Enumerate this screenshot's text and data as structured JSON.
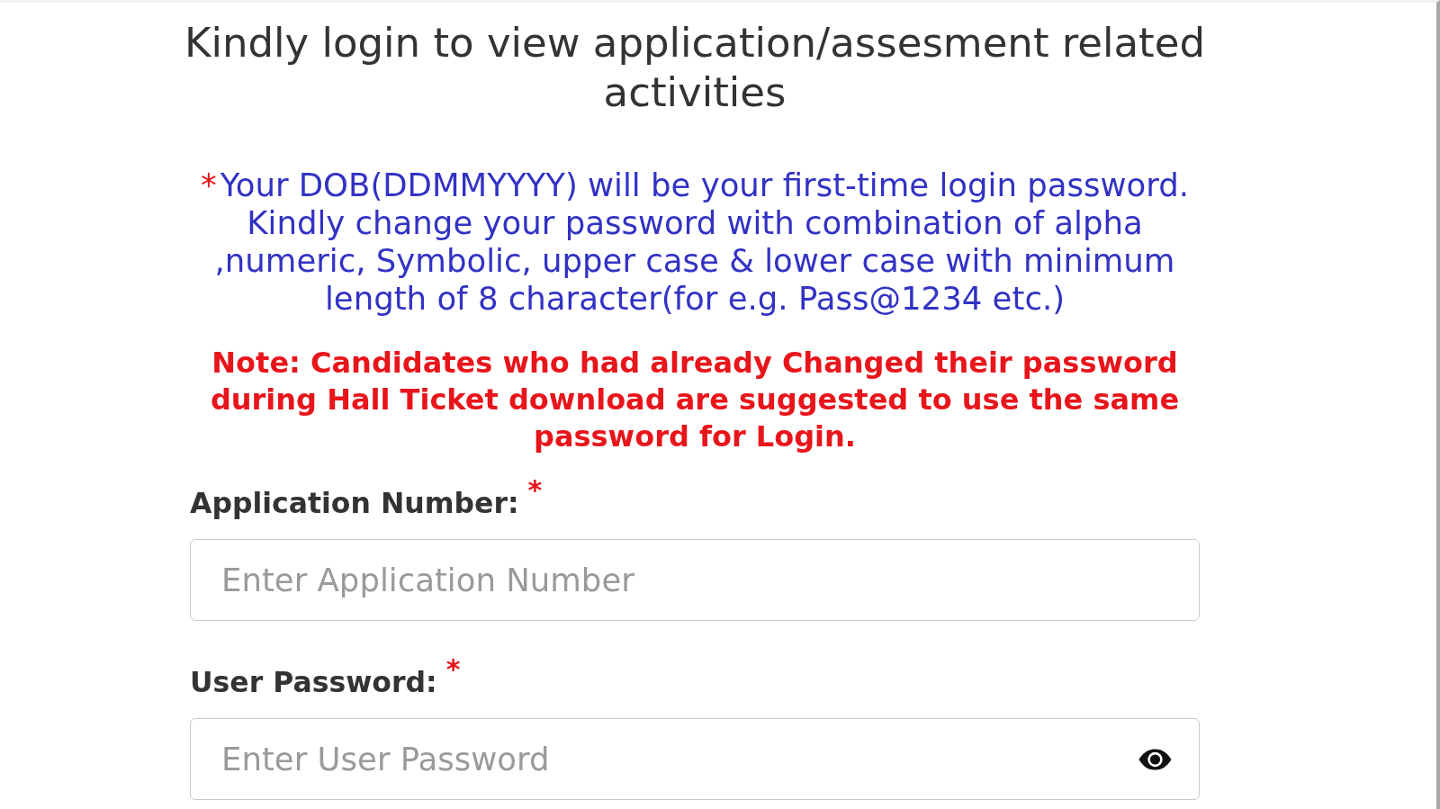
{
  "heading": "Kindly login to view application/assesment related activities",
  "instructions": {
    "marker": "*",
    "text": "Your DOB(DDMMYYYY) will be your first-time login password. Kindly change your password with combination of alpha ,numeric, Symbolic, upper case & lower case with minimum length of 8 character(for e.g. Pass@1234 etc.)"
  },
  "note": "Note: Candidates who had already Changed their password during Hall Ticket download are suggested to use the same password for Login.",
  "fields": [
    {
      "kind": "text",
      "label": "Application Number:",
      "required_mark": "*",
      "placeholder": "Enter Application Number"
    },
    {
      "kind": "password",
      "label": "User Password:",
      "required_mark": "*",
      "placeholder": "Enter User Password"
    }
  ]
}
